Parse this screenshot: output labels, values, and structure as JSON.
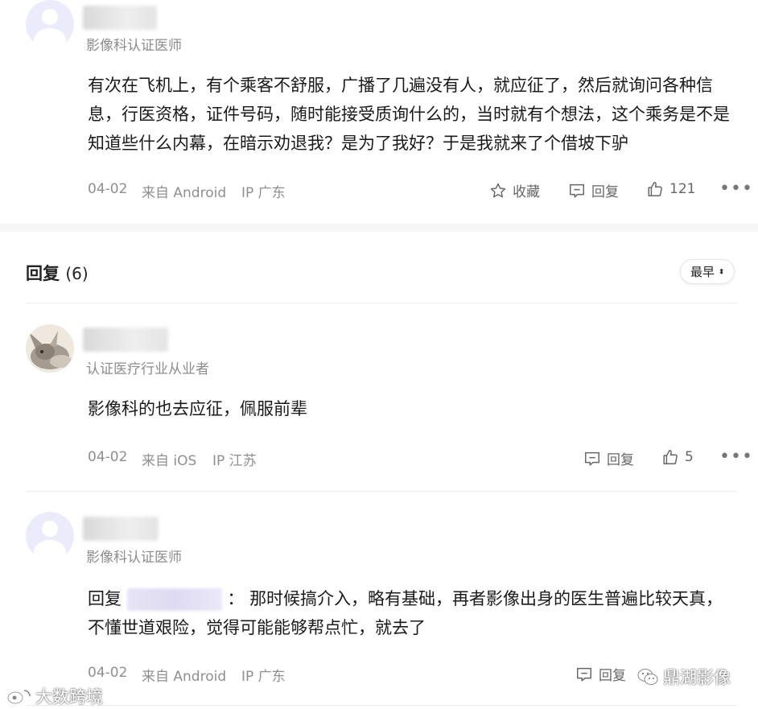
{
  "main_comment": {
    "badge": "影像科认证医师",
    "content": "有次在飞机上，有个乘客不舒服，广播了几遍没有人，就应征了，然后就询问各种信息，行医资格，证件号码，随时能接受质询什么的，当时就有个想法，这个乘务是不是知道些什么内幕，在暗示劝退我？是为了我好？于是我就来了个借坡下驴",
    "date": "04-02",
    "source": "来自 Android",
    "ip": "IP 广东",
    "favorite_label": "收藏",
    "reply_label": "回复",
    "like_count": "121"
  },
  "replies_header": {
    "title": "回复",
    "count": "(6)",
    "sort_label": "最早"
  },
  "replies": [
    {
      "badge": "认证医疗行业从业者",
      "content": "影像科的也去应征，佩服前辈",
      "date": "04-02",
      "source": "来自 iOS",
      "ip": "IP 江苏",
      "reply_label": "回复",
      "like_count": "5"
    },
    {
      "badge": "影像科认证医师",
      "reply_prefix": "回复",
      "reply_colon": "：",
      "content": "那时候搞介入，略有基础，再者影像出身的医生普遍比较天真，不懂世道艰险，觉得可能能够帮点忙，就去了",
      "date": "04-02",
      "source": "来自 Android",
      "ip": "IP 广东",
      "reply_label": "回复"
    }
  ],
  "watermarks": {
    "left": "大数跨境",
    "right": "鼎湖影像"
  },
  "colors": {
    "text": "#1a1a1a",
    "meta": "#8f8f8f",
    "avatar_bg": "#ecebfb"
  }
}
